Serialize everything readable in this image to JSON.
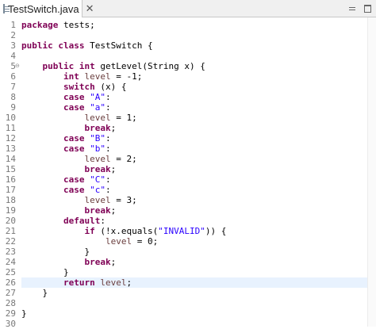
{
  "tab": {
    "title": "TestSwitch.java",
    "close": "✕"
  },
  "colors": {
    "keyword": "#7f0055",
    "string": "#2a00ff",
    "variable": "#6a3e3e",
    "current_line": "#e8f2fe",
    "line_number": "#787878"
  },
  "icons": {
    "file": "java-file-icon",
    "close": "close-icon",
    "minimize": "minimize-icon",
    "maximize": "maximize-icon",
    "fold": "fold-collapse-icon"
  },
  "fold_marker": "⊖",
  "current_line": 26,
  "lines": [
    {
      "n": "1",
      "tokens": [
        [
          "kw",
          "package"
        ],
        [
          "pl",
          " tests;"
        ]
      ]
    },
    {
      "n": "2",
      "tokens": []
    },
    {
      "n": "3",
      "tokens": [
        [
          "kw",
          "public"
        ],
        [
          "pl",
          " "
        ],
        [
          "kw",
          "class"
        ],
        [
          "pl",
          " TestSwitch {"
        ]
      ]
    },
    {
      "n": "4",
      "tokens": []
    },
    {
      "n": "5",
      "fold": true,
      "tokens": [
        [
          "pl",
          "    "
        ],
        [
          "kw",
          "public"
        ],
        [
          "pl",
          " "
        ],
        [
          "kw",
          "int"
        ],
        [
          "pl",
          " getLevel(String x) {"
        ]
      ]
    },
    {
      "n": "6",
      "tokens": [
        [
          "pl",
          "        "
        ],
        [
          "kw",
          "int"
        ],
        [
          "pl",
          " "
        ],
        [
          "var",
          "level"
        ],
        [
          "pl",
          " = -1;"
        ]
      ]
    },
    {
      "n": "7",
      "tokens": [
        [
          "pl",
          "        "
        ],
        [
          "kw",
          "switch"
        ],
        [
          "pl",
          " (x) {"
        ]
      ]
    },
    {
      "n": "8",
      "tokens": [
        [
          "pl",
          "        "
        ],
        [
          "kw",
          "case"
        ],
        [
          "pl",
          " "
        ],
        [
          "str",
          "\"A\""
        ],
        [
          "pl",
          ":"
        ]
      ]
    },
    {
      "n": "9",
      "tokens": [
        [
          "pl",
          "        "
        ],
        [
          "kw",
          "case"
        ],
        [
          "pl",
          " "
        ],
        [
          "str",
          "\"a\""
        ],
        [
          "pl",
          ":"
        ]
      ]
    },
    {
      "n": "10",
      "tokens": [
        [
          "pl",
          "            "
        ],
        [
          "var",
          "level"
        ],
        [
          "pl",
          " = 1;"
        ]
      ]
    },
    {
      "n": "11",
      "tokens": [
        [
          "pl",
          "            "
        ],
        [
          "kw",
          "break"
        ],
        [
          "pl",
          ";"
        ]
      ]
    },
    {
      "n": "12",
      "tokens": [
        [
          "pl",
          "        "
        ],
        [
          "kw",
          "case"
        ],
        [
          "pl",
          " "
        ],
        [
          "str",
          "\"B\""
        ],
        [
          "pl",
          ":"
        ]
      ]
    },
    {
      "n": "13",
      "tokens": [
        [
          "pl",
          "        "
        ],
        [
          "kw",
          "case"
        ],
        [
          "pl",
          " "
        ],
        [
          "str",
          "\"b\""
        ],
        [
          "pl",
          ":"
        ]
      ]
    },
    {
      "n": "14",
      "tokens": [
        [
          "pl",
          "            "
        ],
        [
          "var",
          "level"
        ],
        [
          "pl",
          " = 2;"
        ]
      ]
    },
    {
      "n": "15",
      "tokens": [
        [
          "pl",
          "            "
        ],
        [
          "kw",
          "break"
        ],
        [
          "pl",
          ";"
        ]
      ]
    },
    {
      "n": "16",
      "tokens": [
        [
          "pl",
          "        "
        ],
        [
          "kw",
          "case"
        ],
        [
          "pl",
          " "
        ],
        [
          "str",
          "\"C\""
        ],
        [
          "pl",
          ":"
        ]
      ]
    },
    {
      "n": "17",
      "tokens": [
        [
          "pl",
          "        "
        ],
        [
          "kw",
          "case"
        ],
        [
          "pl",
          " "
        ],
        [
          "str",
          "\"c\""
        ],
        [
          "pl",
          ":"
        ]
      ]
    },
    {
      "n": "18",
      "tokens": [
        [
          "pl",
          "            "
        ],
        [
          "var",
          "level"
        ],
        [
          "pl",
          " = 3;"
        ]
      ]
    },
    {
      "n": "19",
      "tokens": [
        [
          "pl",
          "            "
        ],
        [
          "kw",
          "break"
        ],
        [
          "pl",
          ";"
        ]
      ]
    },
    {
      "n": "20",
      "tokens": [
        [
          "pl",
          "        "
        ],
        [
          "kw",
          "default"
        ],
        [
          "pl",
          ":"
        ]
      ]
    },
    {
      "n": "21",
      "tokens": [
        [
          "pl",
          "            "
        ],
        [
          "kw",
          "if"
        ],
        [
          "pl",
          " (!x.equals("
        ],
        [
          "str",
          "\"INVALID\""
        ],
        [
          "pl",
          ")) {"
        ]
      ]
    },
    {
      "n": "22",
      "tokens": [
        [
          "pl",
          "                "
        ],
        [
          "var",
          "level"
        ],
        [
          "pl",
          " = 0;"
        ]
      ]
    },
    {
      "n": "23",
      "tokens": [
        [
          "pl",
          "            }"
        ]
      ]
    },
    {
      "n": "24",
      "tokens": [
        [
          "pl",
          "            "
        ],
        [
          "kw",
          "break"
        ],
        [
          "pl",
          ";"
        ]
      ]
    },
    {
      "n": "25",
      "tokens": [
        [
          "pl",
          "        }"
        ]
      ]
    },
    {
      "n": "26",
      "tokens": [
        [
          "pl",
          "        "
        ],
        [
          "kw",
          "return"
        ],
        [
          "pl",
          " "
        ],
        [
          "var",
          "level"
        ],
        [
          "pl",
          ";"
        ]
      ]
    },
    {
      "n": "27",
      "tokens": [
        [
          "pl",
          "    }"
        ]
      ]
    },
    {
      "n": "28",
      "tokens": []
    },
    {
      "n": "29",
      "tokens": [
        [
          "pl",
          "}"
        ]
      ]
    },
    {
      "n": "30",
      "tokens": []
    }
  ]
}
